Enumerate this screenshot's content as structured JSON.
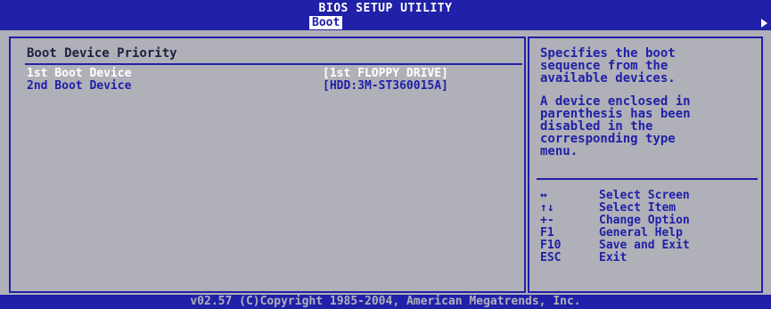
{
  "header": {
    "title": "BIOS SETUP UTILITY",
    "active_tab": "Boot"
  },
  "main": {
    "section_title": "Boot Device Priority",
    "items": [
      {
        "label": "1st Boot Device",
        "value": "[1st FLOPPY DRIVE]"
      },
      {
        "label": "2nd Boot Device",
        "value": "[HDD:3M-ST360015A]"
      }
    ]
  },
  "help": {
    "description_1": "Specifies the boot\nsequence from the\navailable devices.",
    "description_2": "A device enclosed in\nparenthesis has been\ndisabled in the\ncorresponding type\nmenu.",
    "keys": [
      {
        "key": "↔",
        "action": "Select Screen"
      },
      {
        "key": "↑↓",
        "action": "Select Item"
      },
      {
        "key": "+-",
        "action": "Change Option"
      },
      {
        "key": "F1",
        "action": "General Help"
      },
      {
        "key": "F10",
        "action": "Save and Exit"
      },
      {
        "key": "ESC",
        "action": "Exit"
      }
    ]
  },
  "footer": {
    "copyright": "v02.57 (C)Copyright 1985-2004, American Megatrends, Inc."
  },
  "colors": {
    "bios_blue": "#2020a8",
    "background_gray": "#b0b0b8",
    "highlight_white": "#ffffff"
  },
  "icons": {
    "scroll_right": "triangle-right-icon"
  }
}
